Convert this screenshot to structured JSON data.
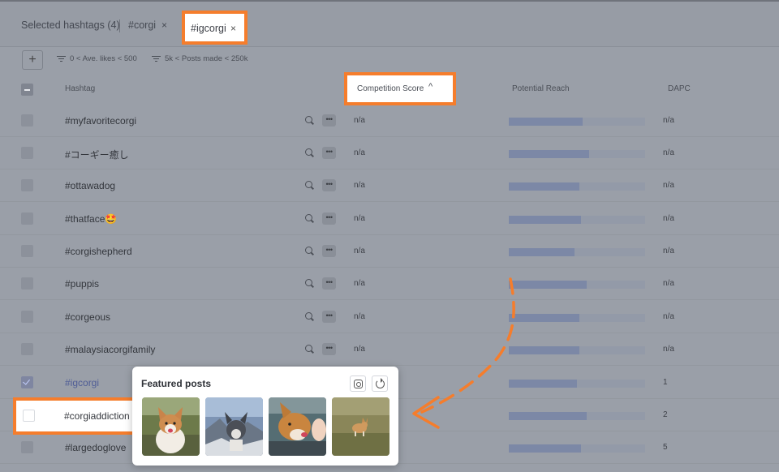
{
  "tabs": {
    "selected_label": "Selected hashtags (4)",
    "items": [
      {
        "label": "#corgi",
        "close": "×"
      },
      {
        "label": "#igcorgi",
        "close": "×"
      }
    ]
  },
  "toolbar": {
    "add_label": "+",
    "filters": [
      "0 < Ave. likes < 500",
      "5k < Posts made < 250k"
    ]
  },
  "table": {
    "columns": {
      "hashtag": "Hashtag",
      "competition": "Competition Score",
      "competition_sort": "^",
      "reach": "Potential Reach",
      "dapc": "DAPC"
    },
    "rows": [
      {
        "tag": "#myfavoritecorgi",
        "comp": "n/a",
        "reach": 0.54,
        "dapc": "n/a"
      },
      {
        "tag": "#コーギー癒し",
        "comp": "n/a",
        "reach": 0.59,
        "dapc": "n/a"
      },
      {
        "tag": "#ottawadog",
        "comp": "n/a",
        "reach": 0.52,
        "dapc": "n/a"
      },
      {
        "tag": "#thatface🤩",
        "comp": "n/a",
        "reach": 0.53,
        "dapc": "n/a"
      },
      {
        "tag": "#corgishepherd",
        "comp": "n/a",
        "reach": 0.48,
        "dapc": "n/a"
      },
      {
        "tag": "#puppis",
        "comp": "n/a",
        "reach": 0.57,
        "dapc": "n/a"
      },
      {
        "tag": "#corgeous",
        "comp": "n/a",
        "reach": 0.52,
        "dapc": "n/a"
      },
      {
        "tag": "#malaysiacorgifamily",
        "comp": "n/a",
        "reach": 0.52,
        "dapc": "n/a"
      },
      {
        "tag": "#igcorgi",
        "comp": "",
        "reach": 0.5,
        "dapc": "1",
        "checked": true
      },
      {
        "tag": "#corgiaddiction",
        "comp": "",
        "reach": 0.57,
        "dapc": "2"
      },
      {
        "tag": "#largedoglove",
        "comp": "",
        "reach": 0.53,
        "dapc": "5"
      }
    ]
  },
  "popup": {
    "title": "Featured posts",
    "icons": [
      "instagram-icon",
      "refresh-icon"
    ]
  },
  "colors": {
    "highlight": "#f57d2c",
    "overlay": "#9a9fa8"
  }
}
